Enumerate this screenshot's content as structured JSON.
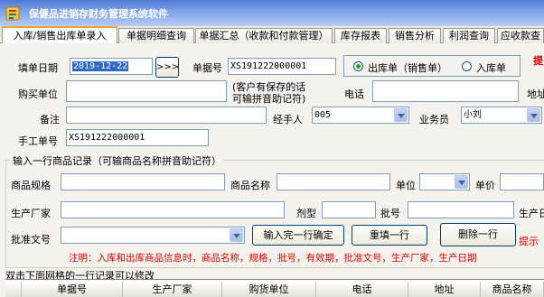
{
  "window": {
    "title": "保健品进销存财务管理系统软件"
  },
  "tabs": [
    {
      "label": "入库/销售出库单录入",
      "active": true
    },
    {
      "label": "单据明细查询"
    },
    {
      "label": "单据汇总（收款和付款管理）"
    },
    {
      "label": "库存报表"
    },
    {
      "label": "销售分析"
    },
    {
      "label": "利润查询"
    },
    {
      "label": "应收款查"
    }
  ],
  "form": {
    "date_label": "填单日期",
    "date_value": "2019-12-22",
    "date_button": ">>>",
    "doc_no_label": "单据号",
    "doc_no_value": "XS191222000001",
    "radio_out": "出库单（销售单）",
    "radio_in": "入库单",
    "hint_right": "提",
    "buyer_label": "购买单位",
    "buyer_note_1": "(客户有保存的话",
    "buyer_note_2": "可输拼音助记符)",
    "phone_label": "电话",
    "address_label": "地址",
    "remark_label": "备注",
    "handler_label": "经手人",
    "handler_value": "005",
    "salesman_label": "业务员",
    "salesman_value": "小刘",
    "manual_no_label": "手工单号",
    "manual_no_value": "XS191222000001"
  },
  "item_section": {
    "title": "输入一行商品记录（可输商品名称拼音助记符）",
    "spec_label": "商品规格",
    "name_label": "商品名称",
    "unit_label": "单位",
    "price_label": "单价",
    "maker_label": "生产厂家",
    "form_label": "剂型",
    "batch_label": "批号",
    "maker2_label": "生产日",
    "approval_label": "批准文号",
    "confirm_button": "输入完一行确定",
    "refill_button": "重填一行",
    "delete_button": "删除一行",
    "tip_label": "提示",
    "note": "注明：入库和出库商品信息时，商品名称，规格，批号，有效期，批准文号，生产厂家，生产日期"
  },
  "grid": {
    "caption": "双击下面网格的一行记录可以修改",
    "columns": [
      "单据号",
      "生产厂家",
      "购货单位",
      "电话",
      "地址",
      "商品名称"
    ]
  },
  "colors": {
    "accent_tab": "#f6a826",
    "note_red": "#e00000",
    "title_bar": "#4f79d6"
  }
}
